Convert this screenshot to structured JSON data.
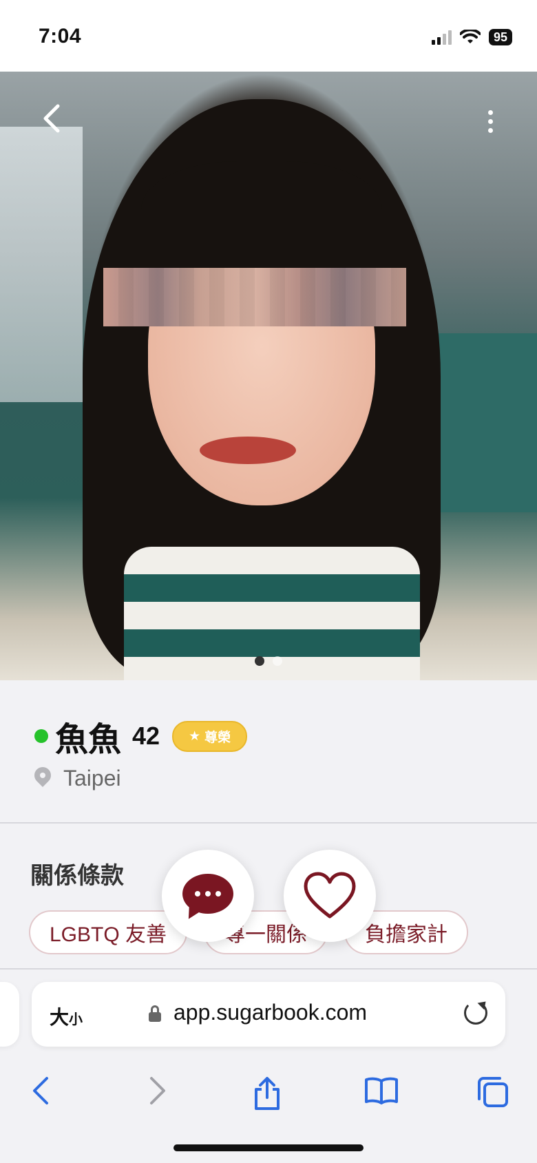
{
  "status_bar": {
    "time": "7:04",
    "battery": "95"
  },
  "photo": {
    "alt": "Profile photo",
    "page_count": 2,
    "current_page": 1
  },
  "profile": {
    "name": "魚魚",
    "age": "42",
    "badge": "尊榮",
    "location": "Taipei",
    "online": true
  },
  "terms": {
    "title": "關係條款",
    "chips": [
      "LGBTQ 友善",
      "專一關係",
      "負擔家計"
    ]
  },
  "actions": {
    "chat": "chat-icon",
    "like": "heart-icon"
  },
  "browser": {
    "text_size_label_big": "大",
    "text_size_label_small": "小",
    "url": "app.sugarbook.com"
  },
  "colors": {
    "accent": "#7a1622",
    "online": "#26c22b",
    "badge": "#f5c842",
    "safari_blue": "#2d6be0"
  }
}
